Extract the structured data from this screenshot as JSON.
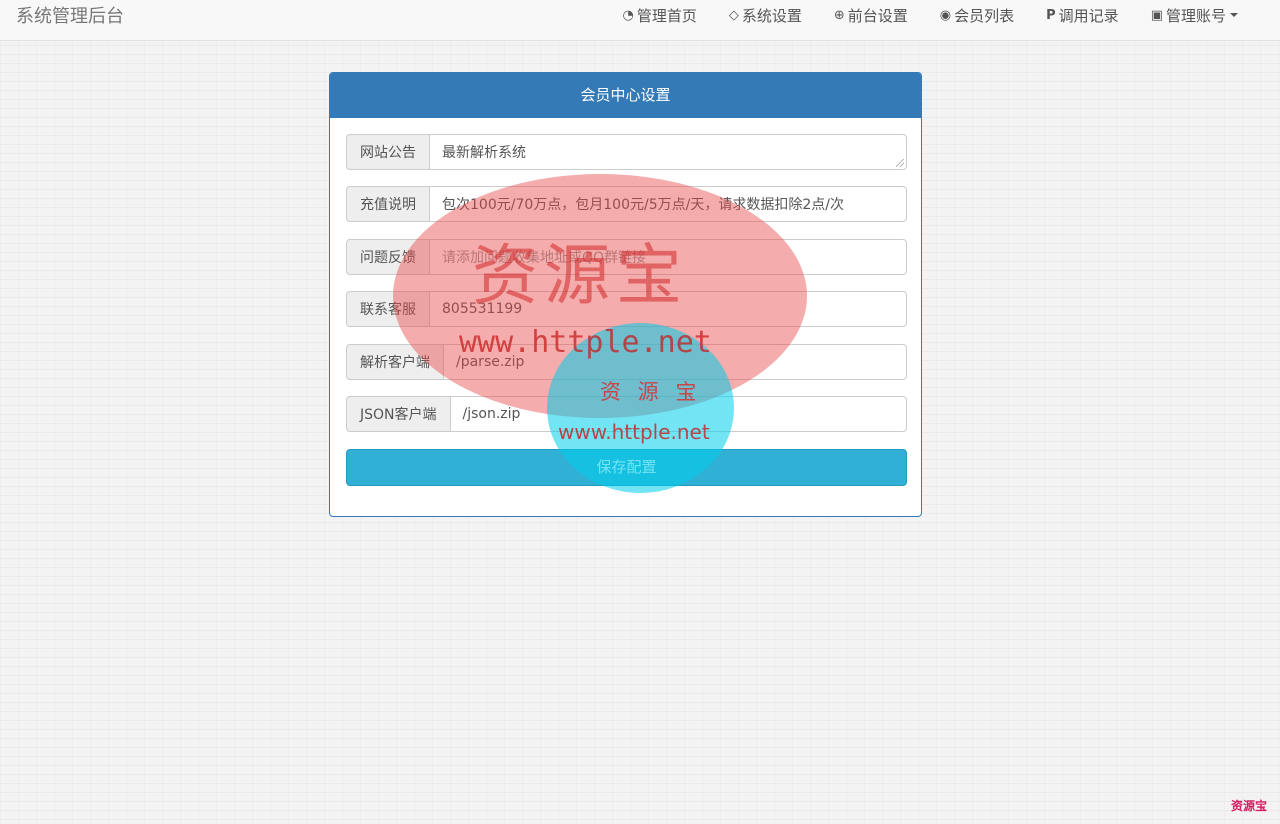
{
  "header": {
    "brand": "系统管理后台",
    "nav": [
      {
        "label": "管理首页",
        "icon": "dashboard-icon",
        "glyph": "◔"
      },
      {
        "label": "系统设置",
        "icon": "diamond-icon",
        "glyph": "◇"
      },
      {
        "label": "前台设置",
        "icon": "lifebuoy-icon",
        "glyph": "⊕"
      },
      {
        "label": "会员列表",
        "icon": "user-circle-icon",
        "glyph": "◉"
      },
      {
        "label": "调用记录",
        "icon": "paypal-icon",
        "glyph": "P"
      },
      {
        "label": "管理账号",
        "icon": "lock-icon",
        "glyph": "▣"
      }
    ]
  },
  "panel": {
    "title": "会员中心设置",
    "fields": [
      {
        "label": "网站公告",
        "value": "最新解析系统",
        "placeholder": ""
      },
      {
        "label": "充值说明",
        "value": "包次100元/70万点，包月100元/5万点/天，请求数据扣除2点/次",
        "placeholder": ""
      },
      {
        "label": "问题反馈",
        "value": "",
        "placeholder": "请添加问题收集地址或QQ群链接"
      },
      {
        "label": "联系客服",
        "value": "805531199",
        "placeholder": ""
      },
      {
        "label": "解析客户端",
        "value": "/parse.zip",
        "placeholder": ""
      },
      {
        "label": "JSON客户端",
        "value": "/json.zip",
        "placeholder": ""
      }
    ],
    "save_label": "保存配置"
  },
  "watermark": {
    "text_large": "资源宝",
    "url_large": "www.httple.net",
    "text_small": "资 源 宝",
    "url_small": "www.httple.net",
    "corner": "资源宝"
  },
  "colors": {
    "primary": "#337ab7",
    "info": "#31b0d5"
  }
}
